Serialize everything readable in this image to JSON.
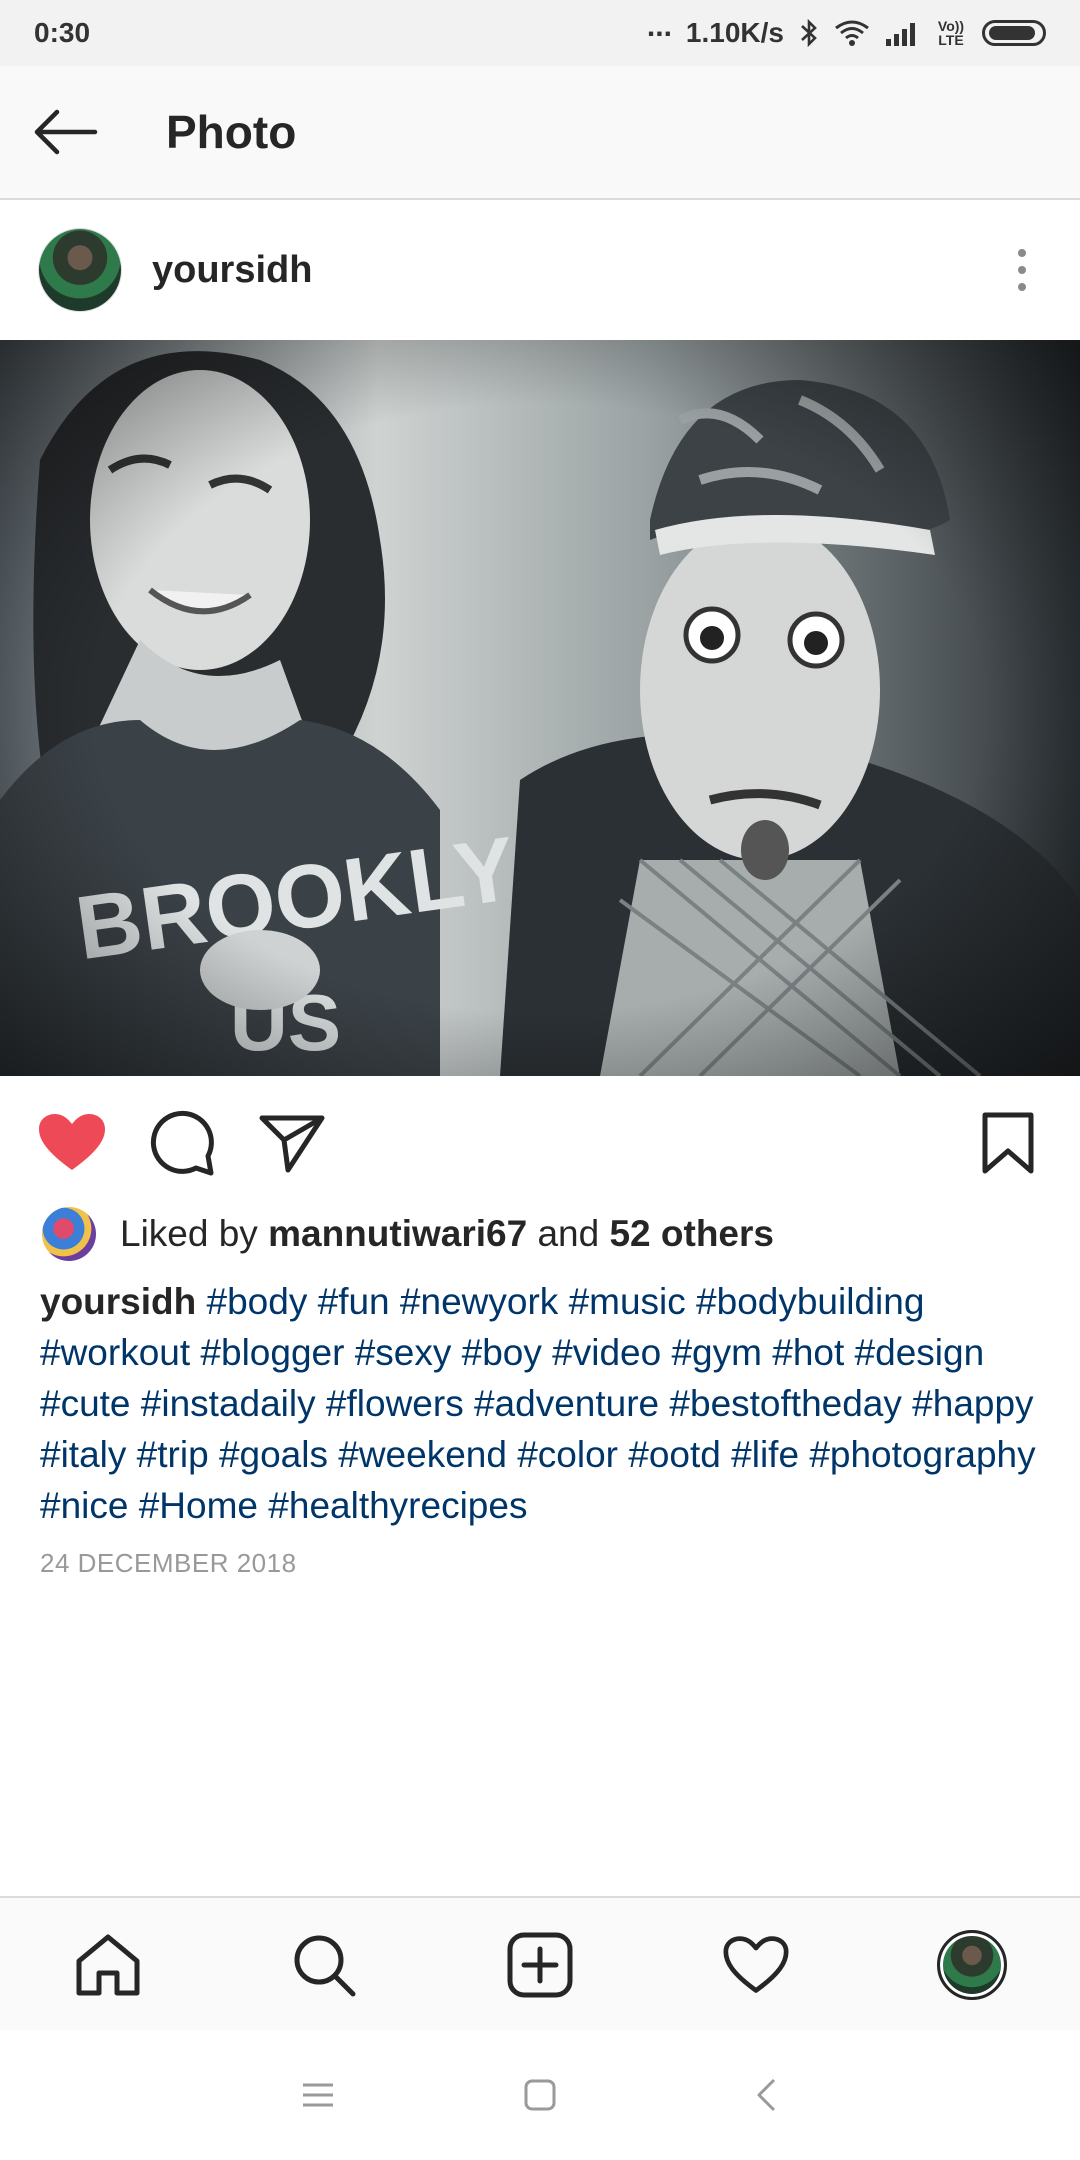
{
  "status_bar": {
    "time": "0:30",
    "dots": "...",
    "network_speed": "1.10K/s",
    "volte": "Vo)) LTE",
    "icons": [
      "bluetooth-icon",
      "wifi-icon",
      "signal-icon",
      "volte-icon",
      "battery-icon"
    ]
  },
  "header": {
    "title": "Photo",
    "back_icon": "arrow-left-icon"
  },
  "post": {
    "username": "yoursidh",
    "more_icon": "more-vertical-icon",
    "photo_icon": "post-photo"
  },
  "actions": {
    "like_icon": "heart-filled-icon",
    "like_color": "#ed4956",
    "comment_icon": "comment-icon",
    "share_icon": "send-icon",
    "save_icon": "bookmark-icon"
  },
  "likes": {
    "prefix": "Liked by",
    "user": "mannutiwari67",
    "conjunction": "and",
    "others": "52 others"
  },
  "caption": {
    "username": "yoursidh",
    "hashtags": [
      "#body",
      "#fun",
      "#newyork",
      "#music",
      "#bodybuilding",
      "#workout",
      "#blogger",
      "#sexy",
      "#boy",
      "#video",
      "#gym",
      "#hot",
      "#design",
      "#cute",
      "#instadaily",
      "#flowers",
      "#adventure",
      "#bestoftheday",
      "#happy",
      "#italy",
      "#trip",
      "#goals",
      "#weekend",
      "#color",
      "#ootd",
      "#life",
      "#photography",
      "#nice",
      "#Home",
      "#healthyrecipes"
    ]
  },
  "date": "24 DECEMBER 2018",
  "bottom_nav": {
    "items": [
      "home-icon",
      "search-icon",
      "add-post-icon",
      "activity-heart-icon",
      "profile-avatar"
    ]
  },
  "system_nav": {
    "items": [
      "menu-icon",
      "home-square-icon",
      "back-chevron-icon"
    ]
  },
  "colors": {
    "link": "#003569",
    "date": "#999999",
    "like": "#ed4956"
  }
}
